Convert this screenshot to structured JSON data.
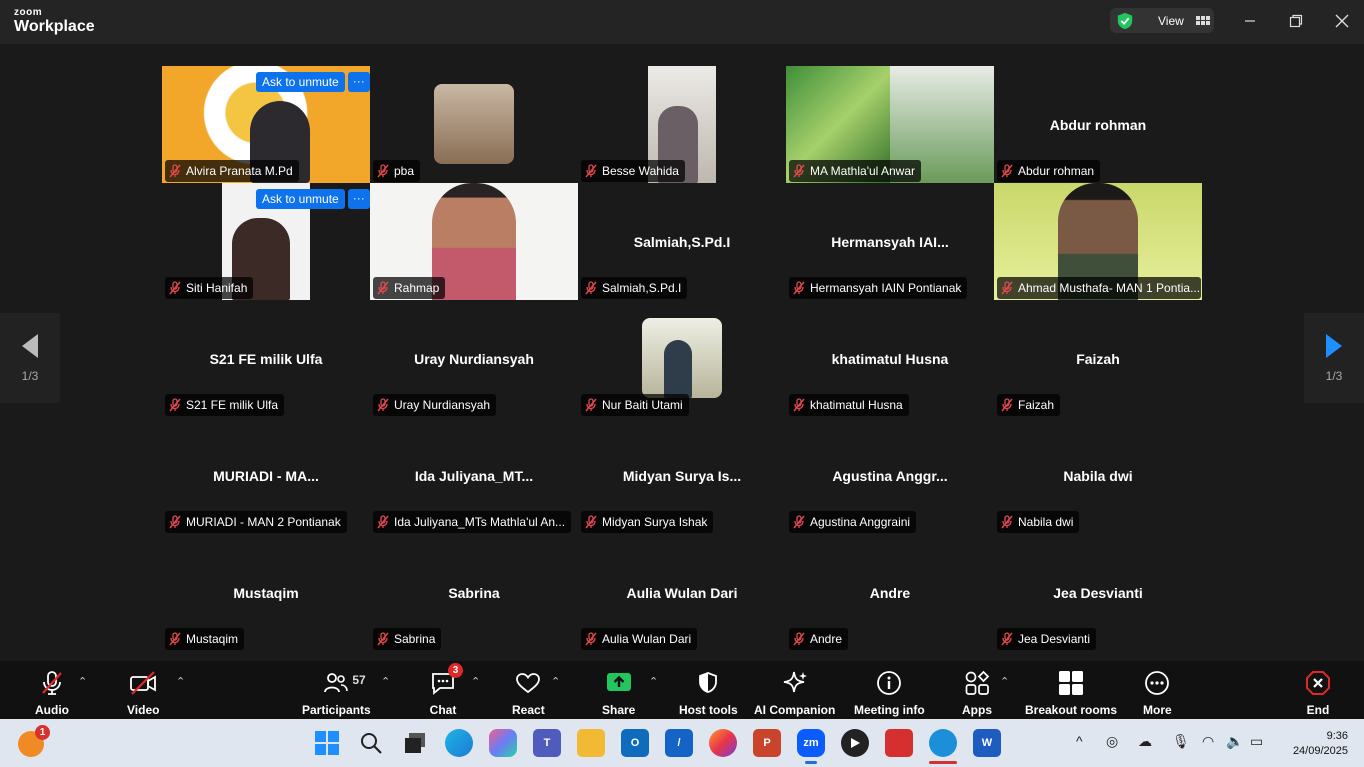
{
  "app": {
    "logo_top": "zoom",
    "logo_bottom": "Workplace",
    "view_label": "View"
  },
  "grid": {
    "ask_to_unmute": "Ask to unmute",
    "more": "···",
    "tiles": [
      {
        "name": "Alvira Pranata M.Pd",
        "display": "",
        "video": true
      },
      {
        "name": "pba",
        "display": "",
        "video": true
      },
      {
        "name": "Besse Wahida",
        "display": "",
        "video": true
      },
      {
        "name": "MA Mathla'ul Anwar",
        "display": "",
        "video": true
      },
      {
        "name": "Abdur rohman",
        "display": "Abdur rohman",
        "video": false
      },
      {
        "name": "Siti Hanifah",
        "display": "",
        "video": true
      },
      {
        "name": "Rahmap",
        "display": "",
        "video": true
      },
      {
        "name": "Salmiah,S.Pd.I",
        "display": "Salmiah,S.Pd.I",
        "video": false
      },
      {
        "name": "Hermansyah IAIN Pontianak",
        "display": "Hermansyah  IAI...",
        "video": false
      },
      {
        "name": "Ahmad Musthafa- MAN 1 Pontia...",
        "display": "",
        "video": true
      },
      {
        "name": "S21 FE milik Ulfa",
        "display": "S21 FE milik Ulfa",
        "video": false
      },
      {
        "name": "Uray Nurdiansyah",
        "display": "Uray Nurdiansyah",
        "video": false
      },
      {
        "name": "Nur Baiti Utami",
        "display": "",
        "video": true
      },
      {
        "name": "khatimatul Husna",
        "display": "khatimatul Husna",
        "video": false
      },
      {
        "name": "Faizah",
        "display": "Faizah",
        "video": false
      },
      {
        "name": "MURIADI - MAN 2 Pontianak",
        "display": "MURIADI - MA...",
        "video": false
      },
      {
        "name": "Ida Juliyana_MTs Mathla'ul An...",
        "display": "Ida  Juliyana_MT...",
        "video": false
      },
      {
        "name": "Midyan Surya Ishak",
        "display": "Midyan Surya Is...",
        "video": false
      },
      {
        "name": "Agustina Anggraini",
        "display": "Agustina  Anggr...",
        "video": false
      },
      {
        "name": "Nabila dwi",
        "display": "Nabila dwi",
        "video": false
      },
      {
        "name": "Mustaqim",
        "display": "Mustaqim",
        "video": false
      },
      {
        "name": "Sabrina",
        "display": "Sabrina",
        "video": false
      },
      {
        "name": "Aulia Wulan Dari",
        "display": "Aulia Wulan Dari",
        "video": false
      },
      {
        "name": "Andre",
        "display": "Andre",
        "video": false
      },
      {
        "name": "Jea Desvianti",
        "display": "Jea Desvianti",
        "video": false
      }
    ]
  },
  "pager": {
    "left": "1/3",
    "right": "1/3"
  },
  "toolbar": {
    "audio": "Audio",
    "video": "Video",
    "participants": "Participants",
    "participant_count": "57",
    "chat": "Chat",
    "chat_badge": "3",
    "react": "React",
    "share": "Share",
    "host_tools": "Host tools",
    "ai_companion": "AI Companion",
    "meeting_info": "Meeting info",
    "apps": "Apps",
    "breakout_rooms": "Breakout rooms",
    "more": "More",
    "end": "End"
  },
  "taskbar": {
    "notification_badge": "1",
    "zoom_label": "zm",
    "time": "9:36",
    "date": "24/09/2025"
  },
  "colors": {
    "accent": "#0e72ed",
    "active_speaker": "#2fd76b",
    "end": "#e02828",
    "share": "#23c55e"
  }
}
